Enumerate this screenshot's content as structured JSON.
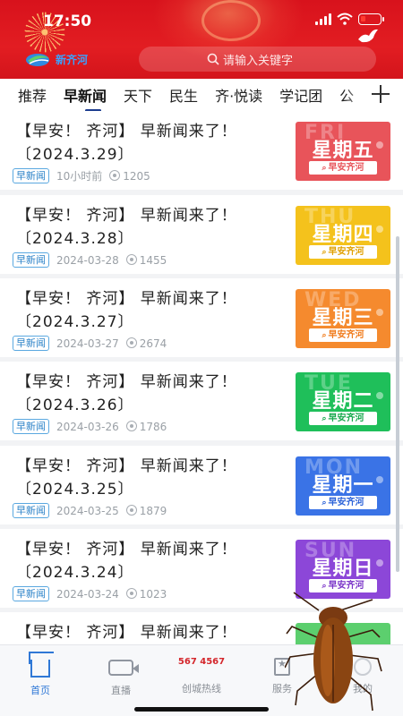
{
  "status_bar": {
    "time": "17:50"
  },
  "header": {
    "logo_text": "新齐河",
    "search_placeholder": "请输入关键字"
  },
  "tabs": [
    {
      "label": "推荐",
      "active": false
    },
    {
      "label": "早新闻",
      "active": true
    },
    {
      "label": "天下",
      "active": false
    },
    {
      "label": "民生",
      "active": false
    },
    {
      "label": "齐·悦读",
      "active": false
    },
    {
      "label": "学记团",
      "active": false
    },
    {
      "label": "公",
      "active": false
    }
  ],
  "articles": [
    {
      "title": "【早安！齐河】早新闻来了！〔2024.3.29〕",
      "line1": "【早安！ 齐河】 早新闻来了！",
      "line2": "〔2024.3.29〕",
      "badge": "早新闻",
      "time": "10小时前",
      "views": "1205",
      "thumb": {
        "eng": "FRI",
        "weekday": "星期五",
        "tag": "早安齐河",
        "color": "#e8545a"
      }
    },
    {
      "title": "【早安！齐河】早新闻来了！〔2024.3.28〕",
      "line1": "【早安！ 齐河】 早新闻来了！",
      "line2": "〔2024.3.28〕",
      "badge": "早新闻",
      "time": "2024-03-28",
      "views": "1455",
      "thumb": {
        "eng": "THU",
        "weekday": "星期四",
        "tag": "早安齐河",
        "color": "#f4c21c"
      }
    },
    {
      "title": "【早安！齐河】早新闻来了！〔2024.3.27〕",
      "line1": "【早安！ 齐河】 早新闻来了！",
      "line2": "〔2024.3.27〕",
      "badge": "早新闻",
      "time": "2024-03-27",
      "views": "2674",
      "thumb": {
        "eng": "WED",
        "weekday": "星期三",
        "tag": "早安齐河",
        "color": "#f58a2e"
      }
    },
    {
      "title": "【早安！齐河】早新闻来了！〔2024.3.26〕",
      "line1": "【早安！ 齐河】 早新闻来了！",
      "line2": "〔2024.3.26〕",
      "badge": "早新闻",
      "time": "2024-03-26",
      "views": "1786",
      "thumb": {
        "eng": "TUE",
        "weekday": "星期二",
        "tag": "早安齐河",
        "color": "#1fbf5a"
      }
    },
    {
      "title": "【早安！齐河】早新闻来了！〔2024.3.25〕",
      "line1": "【早安！ 齐河】 早新闻来了！",
      "line2": "〔2024.3.25〕",
      "badge": "早新闻",
      "time": "2024-03-25",
      "views": "1879",
      "thumb": {
        "eng": "MON",
        "weekday": "星期一",
        "tag": "早安齐河",
        "color": "#3a73e6"
      }
    },
    {
      "title": "【早安！齐河】早新闻来了！〔2024.3.24〕",
      "line1": "【早安！ 齐河】 早新闻来了！",
      "line2": "〔2024.3.24〕",
      "badge": "早新闻",
      "time": "2024-03-24",
      "views": "1023",
      "thumb": {
        "eng": "SUN",
        "weekday": "星期日",
        "tag": "早安齐河",
        "color": "#8c47d8"
      }
    },
    {
      "title": "【早安！齐河】早新闻来了！",
      "line1": "【早安！ 齐河】 早新闻来了！",
      "line2": "",
      "badge": "",
      "time": "",
      "views": "",
      "thumb": {
        "eng": "",
        "weekday": "",
        "tag": "",
        "color": "#5ccf6e"
      }
    }
  ],
  "bottom_nav": [
    {
      "label": "首页",
      "icon": "home-icon",
      "active": true
    },
    {
      "label": "直播",
      "icon": "live-video-icon",
      "active": false
    },
    {
      "label": "创城热线",
      "icon": "hotline-icon",
      "icon_text": "567 4567",
      "active": false
    },
    {
      "label": "服务",
      "icon": "service-star-icon",
      "active": false
    },
    {
      "label": "我的",
      "icon": "user-icon",
      "active": false
    }
  ],
  "colors": {
    "header_red": "#e21d22",
    "tab_underline": "#1c3d8f",
    "nav_active": "#2f78d6",
    "badge_blue": "#2b82c8"
  }
}
